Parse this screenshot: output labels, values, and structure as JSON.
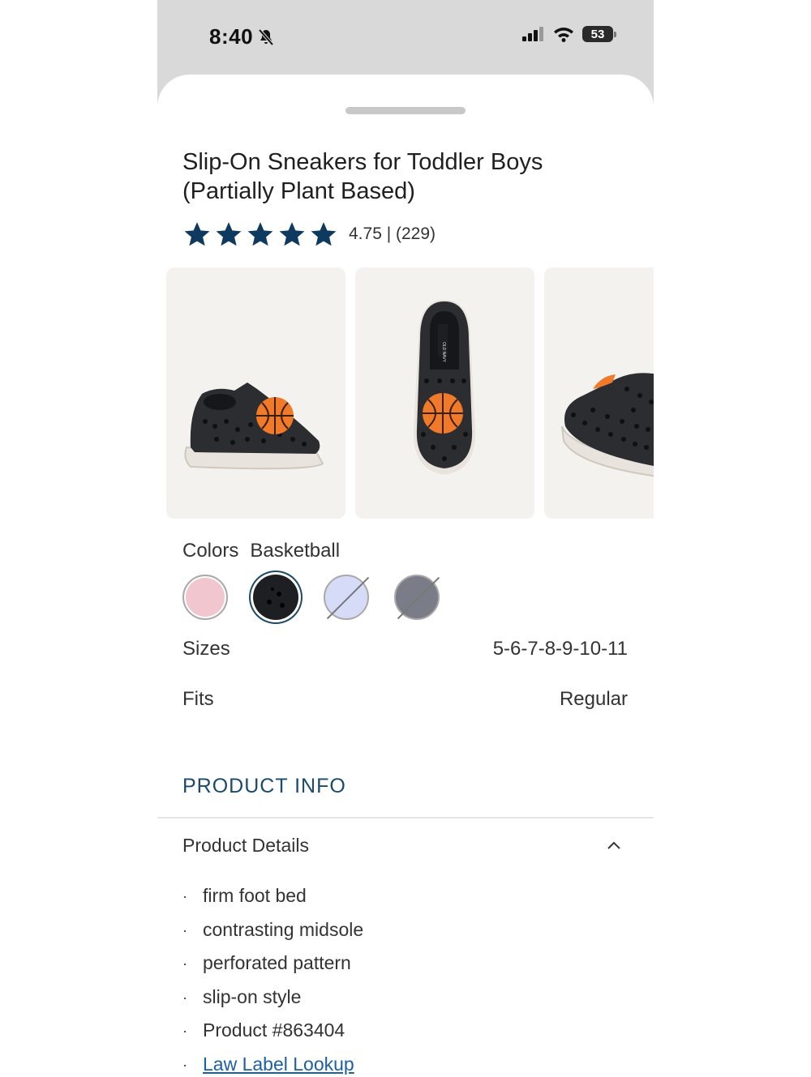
{
  "status_bar": {
    "time": "8:40",
    "battery": "53"
  },
  "product": {
    "title_line1": "Slip-On Sneakers for Toddler Boys",
    "title_line2": "(Partially Plant Based)",
    "rating_value": 4.75,
    "rating_text": "4.75 | (229)",
    "stars": 5
  },
  "colors": {
    "label": "Colors",
    "selected": "Basketball",
    "swatches": [
      {
        "color": "#f1c6cf",
        "state": "available"
      },
      {
        "color": "#1e1f22",
        "state": "selected"
      },
      {
        "color": "#d6dcf7",
        "state": "unavailable"
      },
      {
        "color": "#7a7d87",
        "state": "unavailable"
      }
    ]
  },
  "sizes": {
    "label": "Sizes",
    "value": "5-6-7-8-9-10-11"
  },
  "fits": {
    "label": "Fits",
    "value": "Regular"
  },
  "product_info": {
    "heading": "PRODUCT INFO",
    "details_label": "Product Details",
    "bullets": [
      "firm foot bed",
      "contrasting midsole",
      "perforated pattern",
      "slip-on style",
      "Product #863404"
    ],
    "link": "Law Label Lookup"
  },
  "colors_theme": {
    "star": "#0f3a5f",
    "heading": "#1b4a6b",
    "link": "#1b5fa6"
  }
}
